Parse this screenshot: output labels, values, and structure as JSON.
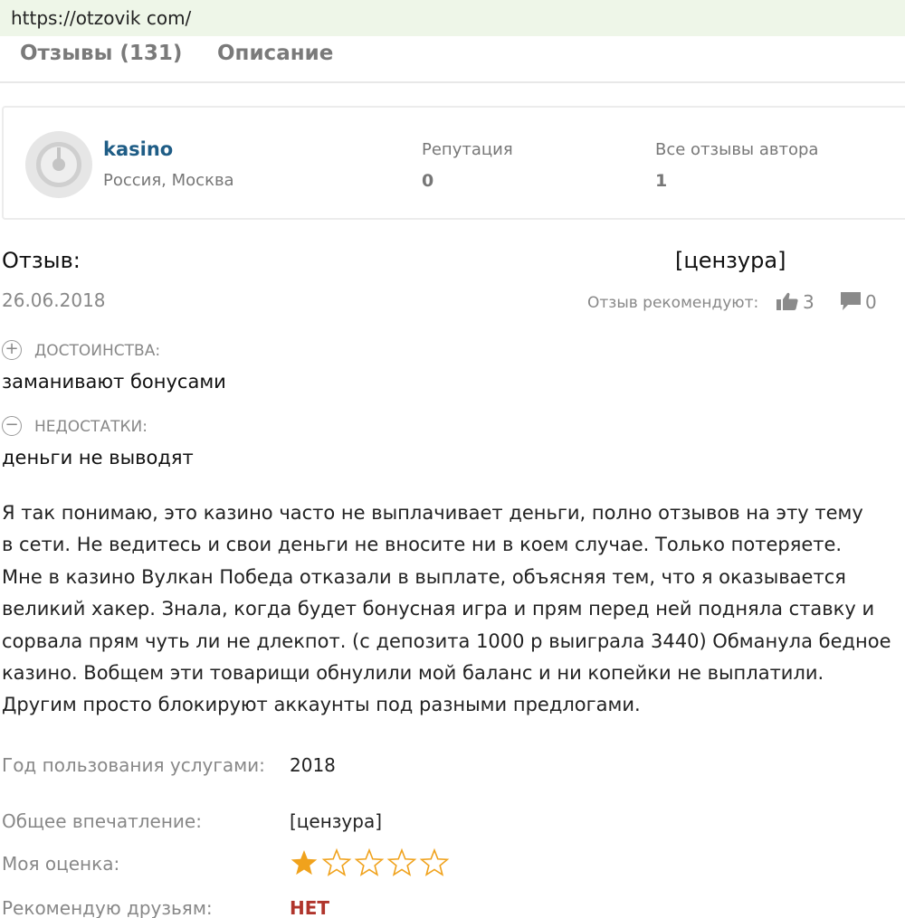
{
  "browser": {
    "url": "https://otzovik com/"
  },
  "tabs": [
    {
      "label": "Отзывы (131)"
    },
    {
      "label": "Описание"
    }
  ],
  "author": {
    "name": "kasino",
    "location": "Россия, Москва",
    "reputation_label": "Репутация",
    "reputation_value": "0",
    "all_reviews_label": "Все отзывы автора",
    "all_reviews_value": "1"
  },
  "review": {
    "title_label": "Отзыв:",
    "title": "[цензура]",
    "date": "26.06.2018",
    "recommend_label": "Отзыв рекомендуют:",
    "likes": "3",
    "comments": "0",
    "pros_label": "ДОСТОИНСТВА:",
    "pros": "заманивают бонусами",
    "cons_label": "НЕДОСТАТКИ:",
    "cons": "деньги не выводят",
    "body_lines": [
      "Я так понимаю, это казино часто не выплачивает деньги, полно отзывов на эту тему",
      "в сети. Не ведитесь и свои деньги не вносите ни в коем случае. Только потеряете.",
      "Мне в казино Вулкан Победа отказали в выплате, объясняя тем, что я оказывается",
      "великий хакер. Знала, когда будет бонусная игра и прям перед ней подняла ставку и",
      "сорвала прям чуть ли не длекпот. (с депозита 1000 р выиграла 3440) Обманула бедное",
      "казино. Вобщем эти товарищи обнулили мой баланс и ни копейки не выплатили.",
      "Другим просто блокируют аккаунты под разными предлогами."
    ],
    "year_label": "Год пользования услугами:",
    "year_value": "2018",
    "impression_label": "Общее впечатление:",
    "impression_value": "[цензура]",
    "rating_label": "Моя оценка:",
    "rating": 1,
    "rating_max": 5,
    "recommend_friends_label": "Рекомендую друзьям:",
    "recommend_friends_value": "НЕТ"
  },
  "colors": {
    "link": "#1f5d86",
    "star_filled": "#f0a21c",
    "star_empty_stroke": "#f0a21c",
    "negative": "#b0352c",
    "url_bar_bg": "#eef6e8"
  },
  "icons": [
    "like-icon",
    "comment-icon",
    "plus-circle-icon",
    "minus-circle-icon",
    "avatar-placeholder-icon",
    "star-icon"
  ]
}
